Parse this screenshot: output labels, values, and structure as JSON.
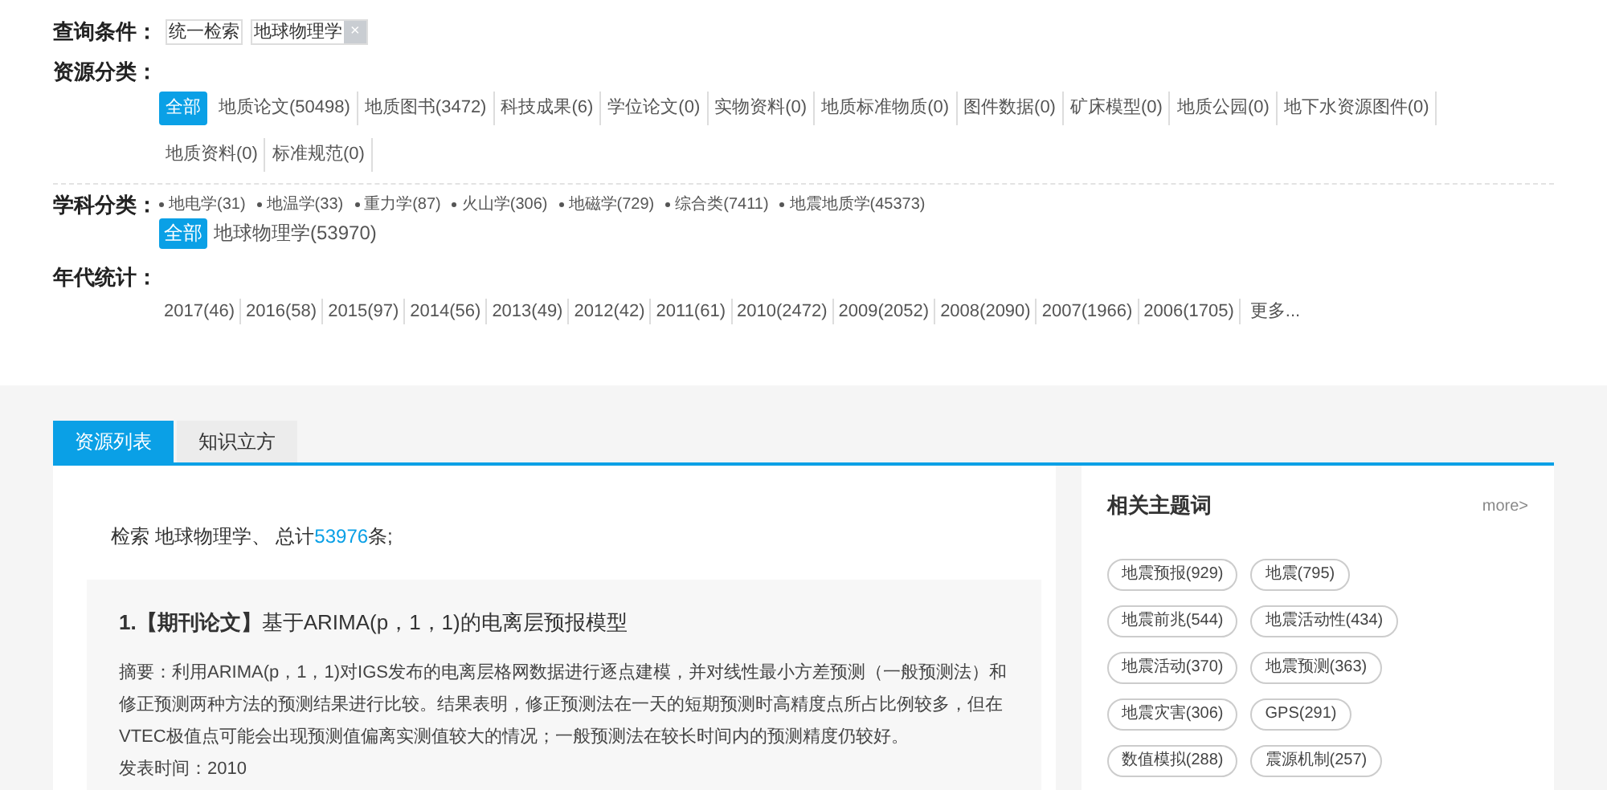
{
  "query": {
    "label": "查询条件：",
    "conditions": [
      {
        "text": "统一检索",
        "removable": false
      },
      {
        "text": "地球物理学",
        "removable": true,
        "remove": "×"
      }
    ]
  },
  "resource": {
    "label": "资源分类：",
    "items": [
      {
        "text": "全部",
        "selected": true
      },
      {
        "text": "地质论文(50498)",
        "selected": false
      },
      {
        "text": "地质图书(3472)",
        "selected": false
      },
      {
        "text": "科技成果(6)",
        "selected": false
      },
      {
        "text": "学位论文(0)",
        "selected": false
      },
      {
        "text": "实物资料(0)",
        "selected": false
      },
      {
        "text": "地质标准物质(0)",
        "selected": false
      },
      {
        "text": "图件数据(0)",
        "selected": false
      },
      {
        "text": "矿床模型(0)",
        "selected": false
      },
      {
        "text": "地质公园(0)",
        "selected": false
      },
      {
        "text": "地下水资源图件(0)",
        "selected": false
      },
      {
        "text": "地质资料(0)",
        "selected": false
      },
      {
        "text": "标准规范(0)",
        "selected": false
      }
    ]
  },
  "subject": {
    "label": "学科分类：",
    "items": [
      {
        "kind": "bullet",
        "text": "地电学(31)",
        "selected": false
      },
      {
        "kind": "bullet",
        "text": "地温学(33)",
        "selected": false
      },
      {
        "kind": "bullet",
        "text": "重力学(87)",
        "selected": false
      },
      {
        "kind": "bullet",
        "text": "火山学(306)",
        "selected": false
      },
      {
        "kind": "bullet",
        "text": "地磁学(729)",
        "selected": false
      },
      {
        "kind": "bullet",
        "text": "综合类(7411)",
        "selected": false
      },
      {
        "kind": "bullet",
        "text": "地震地质学(45373)",
        "selected": false
      },
      {
        "kind": "plain",
        "text": "全部",
        "selected": true
      },
      {
        "kind": "plain",
        "text": "地球物理学(53970)",
        "selected": false
      }
    ]
  },
  "years": {
    "label": "年代统计：",
    "items": [
      "2017(46)",
      "2016(58)",
      "2015(97)",
      "2014(56)",
      "2013(49)",
      "2012(42)",
      "2011(61)",
      "2010(2472)",
      "2009(2052)",
      "2008(2090)",
      "2007(1966)",
      "2006(1705)"
    ],
    "more": "更多..."
  },
  "tabs": [
    {
      "label": "资源列表",
      "selected": true
    },
    {
      "label": "知识立方",
      "selected": false
    }
  ],
  "summary": {
    "prefix": "检索 地球物理学、 总计",
    "count": "53976",
    "suffix": "条;"
  },
  "results": [
    {
      "index": "1.",
      "type": "【期刊论文】",
      "title": "基于ARIMA(p，1，1)的电离层预报模型",
      "abstract": "摘要：利用ARIMA(p，1，1)对IGS发布的电离层格网数据进行逐点建模，并对线性最小方差预测（一般预测法）和修正预测两种方法的预测结果进行比较。结果表明，修正预测法在一天的短期预测时高精度点所占比例较多，但在VTEC极值点可能会出现预测值偏离实测值较大的情况；一般预测法在较长时间内的预测精度仍较好。",
      "date": "发表时间：2010"
    }
  ],
  "sidebar": {
    "title": "相关主题词",
    "more": "more>",
    "tags": [
      "地震预报(929)",
      "地震(795)",
      "地震前兆(544)",
      "地震活动性(434)",
      "地震活动(370)",
      "地震预测(363)",
      "地震灾害(306)",
      "GPS(291)",
      "数值模拟(288)",
      "震源机制(257)"
    ]
  }
}
